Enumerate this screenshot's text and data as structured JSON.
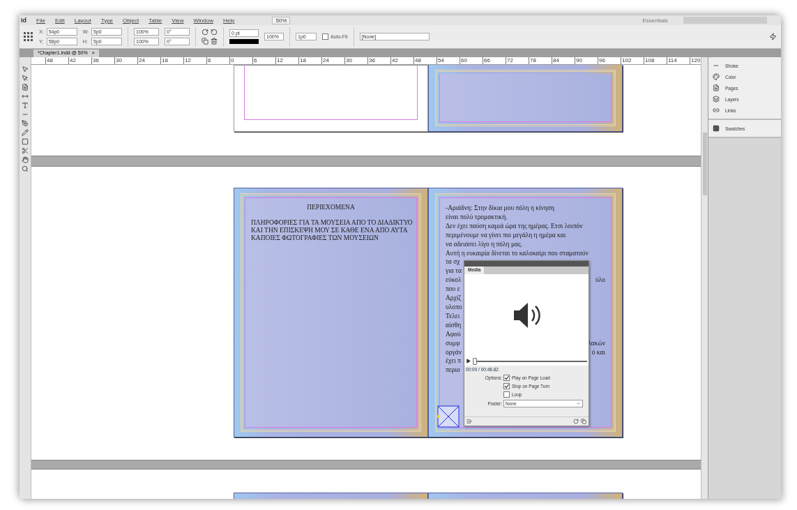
{
  "menu_bar": {
    "logo": "Id",
    "items": [
      "File",
      "Edit",
      "Layout",
      "Type",
      "Object",
      "Table",
      "View",
      "Window",
      "Help"
    ],
    "zoom": "50%",
    "workspace": "Essentials"
  },
  "control_bar": {
    "position": [
      {
        "label": "X:",
        "value": "54p0"
      },
      {
        "label": "Y:",
        "value": "58p0"
      }
    ],
    "size": [
      {
        "label": "W:",
        "value": "5p0"
      },
      {
        "label": "H:",
        "value": "5p0"
      }
    ],
    "scale": [
      "100%",
      "100%"
    ],
    "angles": [
      "0°",
      "0°"
    ],
    "stroke_weight": "0 pt",
    "opacity": "100%",
    "offset": "1p0",
    "auto_fit": {
      "label": "Auto-Fit",
      "checked": false
    },
    "object_style": "[None]"
  },
  "document_tab": {
    "title": "*Chapter1.indd @ 50%",
    "close": "×"
  },
  "ruler": [
    "48",
    "42",
    "36",
    "30",
    "24",
    "18",
    "12",
    "6",
    "0",
    "6",
    "12",
    "18",
    "24",
    "30",
    "36",
    "42",
    "48",
    "54",
    "60",
    "66",
    "72",
    "78",
    "84",
    "90",
    "96",
    "102",
    "108",
    "114",
    "120"
  ],
  "left_page": {
    "title": "ΠΕΡΙΕΧΟΜΕΝΑ",
    "paragraphs": [
      "ΠΛΗΡΟΦΟΡΙΕΣ ΓΙΑ ΤΑ ΜΟΥΣΕΙΑ ΑΠΟ ΤΟ ΔΙΑΔΙΚΤΥΟ",
      "ΚΑΙ ΤΗΝ ΕΠΙΣΚΕΨΗ ΜΟΥ ΣΕ ΚΑΘΕ ΕΝΑ ΑΠΟ ΑΥΤΑ",
      "ΚΑΠΟΙΕΣ ΦΩΤΟΓΡΑΦΙΕΣ ΤΩΝ ΜΟΥΣΕΙΩΝ"
    ]
  },
  "right_page": {
    "lines": [
      {
        "text": "-Αριάδνη: Στην δίκια μου πόλη η κίνηση"
      },
      {
        "text": "είναι πολύ τρομακτική."
      },
      {
        "text": "Δεν έχει παύση καμιά ώρα της ημέρας. Ετσι λοιπόν"
      },
      {
        "text": "περιμένουμε να  γίνει πιο μεγάλη η ημέρα και"
      },
      {
        "text": "να αδειάσει λίγο η πόλη μας."
      },
      {
        "text": "Αυτή η ευκαιρία δίνεται το καλοκαίρι που σταματούν"
      },
      {
        "text": "τα σχ"
      },
      {
        "text": "για τα"
      },
      {
        "text": "εύκολ",
        "tail": "ύλο"
      },
      {
        "text": "που ε"
      },
      {
        "text": "Αρχίζ"
      },
      {
        "text": "υλοπο"
      },
      {
        "text": "Τελει"
      },
      {
        "text": "αίσθη"
      },
      {
        "text": "Αφού"
      },
      {
        "text": "συμφ",
        "tail": "λακών"
      },
      {
        "text": "οργάν",
        "tail": "ό και"
      },
      {
        "text": "έχει π"
      },
      {
        "text": "περιο"
      }
    ]
  },
  "media_panel": {
    "title": "Media",
    "level": 0.02,
    "time": "00:00 / 00:48.82",
    "options_label": "Options:",
    "options": [
      {
        "label": "Play on Page Load",
        "checked": true
      },
      {
        "label": "Stop on Page Turn",
        "checked": true
      },
      {
        "label": "Loop",
        "checked": false
      }
    ],
    "poster_label": "Poster:",
    "poster": "None"
  },
  "side_panels": [
    {
      "label": "Stroke",
      "kind": "stroke"
    },
    {
      "label": "Color",
      "kind": "color"
    },
    {
      "label": "Pages",
      "kind": "pages"
    },
    {
      "label": "Layers",
      "kind": "layers"
    },
    {
      "label": "Links",
      "kind": "links"
    },
    {
      "label": "Swatches",
      "kind": "swatches"
    }
  ]
}
